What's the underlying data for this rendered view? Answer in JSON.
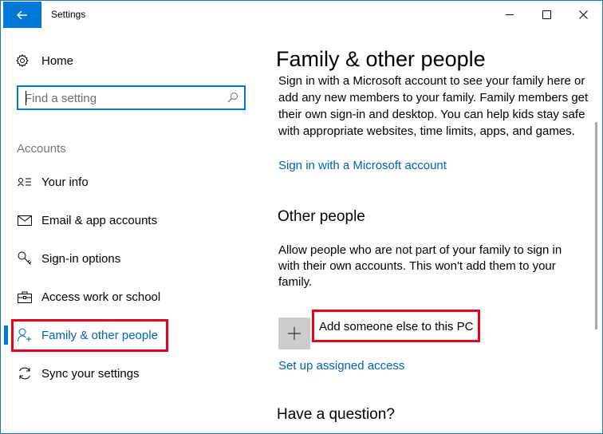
{
  "window": {
    "title": "Settings",
    "accent": "#0078d7",
    "highlight_color": "#e8001c"
  },
  "titlebar": {
    "back_icon": "arrow-left-icon",
    "minimize_icon": "minimize-icon",
    "maximize_icon": "maximize-icon",
    "close_icon": "close-icon"
  },
  "sidebar": {
    "home_label": "Home",
    "home_icon": "gear-icon",
    "search": {
      "placeholder": "Find a setting",
      "value": "",
      "icon": "search-icon"
    },
    "section_label": "Accounts",
    "items": [
      {
        "label": "Your info",
        "icon": "person-card-icon",
        "active": false
      },
      {
        "label": "Email & app accounts",
        "icon": "envelope-icon",
        "active": false
      },
      {
        "label": "Sign-in options",
        "icon": "key-icon",
        "active": false
      },
      {
        "label": "Access work or school",
        "icon": "briefcase-icon",
        "active": false
      },
      {
        "label": "Family & other people",
        "icon": "person-add-icon",
        "active": true
      },
      {
        "label": "Sync your settings",
        "icon": "sync-icon",
        "active": false
      }
    ]
  },
  "main": {
    "title": "Family & other people",
    "intro": "Sign in with a Microsoft account to see your family here or add any new members to your family. Family members get their own sign-in and desktop. You can help kids stay safe with appropriate websites, time limits, apps, and games.",
    "signin_link": "Sign in with a Microsoft account",
    "other_people_heading": "Other people",
    "other_people_text": "Allow people who are not part of your family to sign in with their own accounts. This won't add them to your family.",
    "add_label": "Add someone else to this PC",
    "add_icon": "plus-icon",
    "assigned_access_link": "Set up assigned access",
    "question_heading": "Have a question?"
  }
}
